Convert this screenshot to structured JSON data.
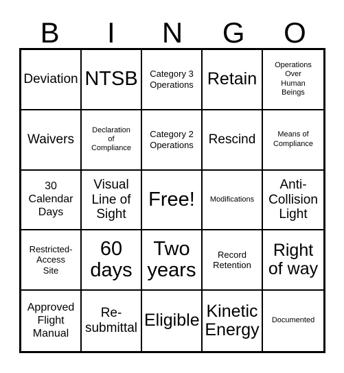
{
  "card": {
    "title_letters": [
      "B",
      "I",
      "N",
      "G",
      "O"
    ],
    "free_space_label": "Free!",
    "colors": {
      "background": "#ffffff",
      "text": "#000000",
      "border": "#000000"
    },
    "grid": {
      "columns": 5,
      "rows": 5,
      "cells": [
        {
          "text": "Deviation",
          "size": "fs-md"
        },
        {
          "text": "NTSB",
          "size": "fs-xl"
        },
        {
          "text": "Category 3\nOperations",
          "size": "fs-xs"
        },
        {
          "text": "Retain",
          "size": "fs-lg"
        },
        {
          "text": "Operations\nOver\nHuman\nBeings",
          "size": "fs-xxs"
        },
        {
          "text": "Waivers",
          "size": "fs-md"
        },
        {
          "text": "Declaration\nof\nCompliance",
          "size": "fs-xxs"
        },
        {
          "text": "Category 2\nOperations",
          "size": "fs-xs"
        },
        {
          "text": "Rescind",
          "size": "fs-md"
        },
        {
          "text": "Means of\nCompliance",
          "size": "fs-xxs"
        },
        {
          "text": "30\nCalendar\nDays",
          "size": "fs-sm"
        },
        {
          "text": "Visual\nLine of\nSight",
          "size": "fs-md"
        },
        {
          "text": "Free!",
          "size": "fs-xl"
        },
        {
          "text": "Modifications",
          "size": "fs-xxs"
        },
        {
          "text": "Anti-\nCollision\nLight",
          "size": "fs-md"
        },
        {
          "text": "Restricted-\nAccess\nSite",
          "size": "fs-xs"
        },
        {
          "text": "60\ndays",
          "size": "fs-xl"
        },
        {
          "text": "Two\nyears",
          "size": "fs-xl"
        },
        {
          "text": "Record\nRetention",
          "size": "fs-xs"
        },
        {
          "text": "Right\nof way",
          "size": "fs-lg"
        },
        {
          "text": "Approved\nFlight\nManual",
          "size": "fs-sm"
        },
        {
          "text": "Re-\nsubmittal",
          "size": "fs-md"
        },
        {
          "text": "Eligible",
          "size": "fs-lg"
        },
        {
          "text": "Kinetic\nEnergy",
          "size": "fs-lg"
        },
        {
          "text": "Documented",
          "size": "fs-xxs"
        }
      ]
    }
  }
}
